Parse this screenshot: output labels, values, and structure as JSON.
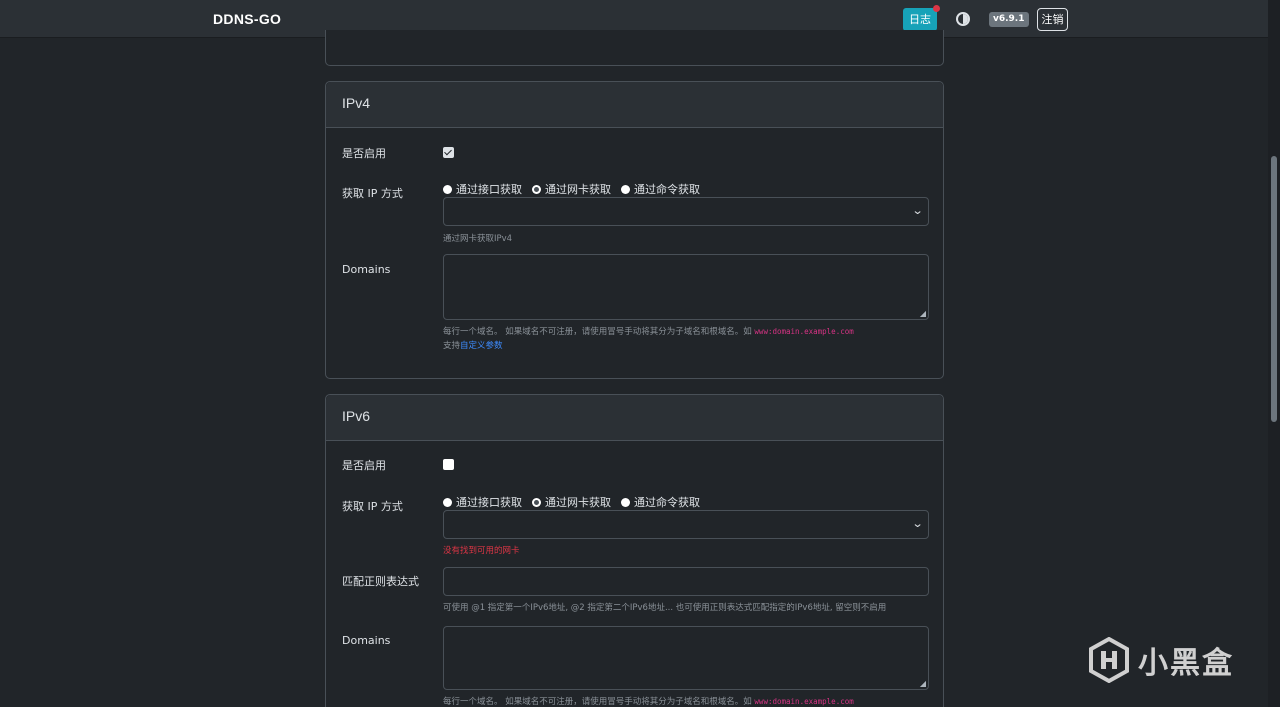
{
  "navbar": {
    "brand": "DDNS-GO",
    "log_label": "日志",
    "version": "v6.9.1",
    "logout_label": "注销",
    "theme_icon": "theme-toggle-icon"
  },
  "ipv4": {
    "title": "IPv4",
    "enable_label": "是否启用",
    "enabled": true,
    "method_label": "获取 IP 方式",
    "methods": [
      "通过接口获取",
      "通过网卡获取",
      "通过命令获取"
    ],
    "selected_method": 1,
    "nic_help": "通过网卡获取IPv4",
    "domains_label": "Domains",
    "domains_help_prefix": "每行一个域名。 如果域名不可注册，请使用冒号手动将其分为子域名和根域名。如",
    "domains_help_example": "www:domain.example.com",
    "custom_params_prefix": "支持",
    "custom_params_link": "自定义参数"
  },
  "ipv6": {
    "title": "IPv6",
    "enable_label": "是否启用",
    "enabled": false,
    "method_label": "获取 IP 方式",
    "methods": [
      "通过接口获取",
      "通过网卡获取",
      "通过命令获取"
    ],
    "selected_method": 1,
    "nic_error": "没有找到可用的网卡",
    "regex_label": "匹配正则表达式",
    "regex_help": "可使用 @1 指定第一个IPv6地址, @2 指定第二个IPv6地址... 也可使用正则表达式匹配指定的IPv6地址, 留空则不启用",
    "domains_label": "Domains",
    "domains_help_prefix": "每行一个域名。 如果域名不可注册，请使用冒号手动将其分为子域名和根域名。如",
    "domains_help_example": "www:domain.example.com"
  },
  "watermark": {
    "text": "小黑盒"
  },
  "colors": {
    "accent": "#17a2b8",
    "danger": "#dc3545",
    "link": "#3d8bfd",
    "code": "#d63384"
  }
}
